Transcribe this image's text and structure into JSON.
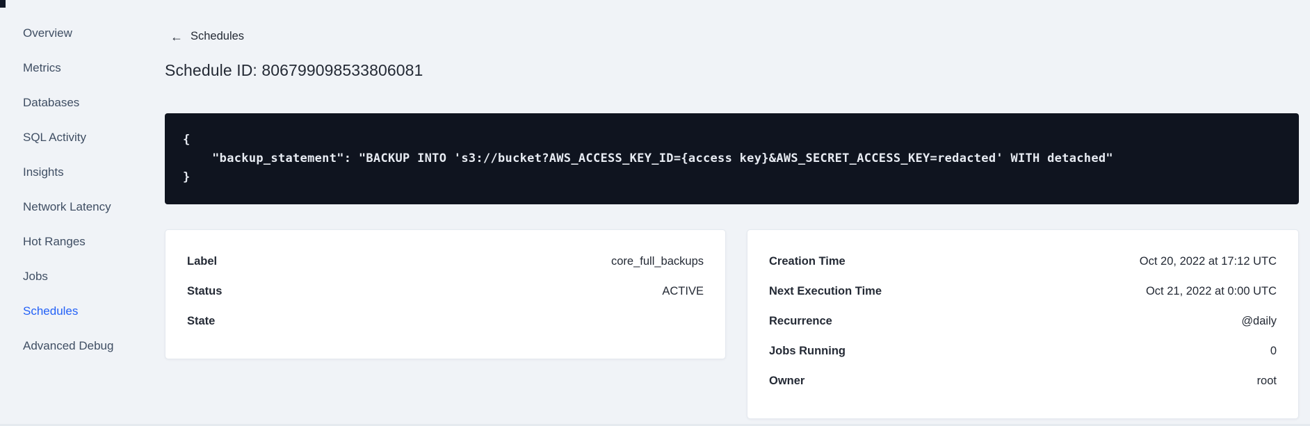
{
  "sidebar": {
    "items": [
      {
        "label": "Overview",
        "active": false
      },
      {
        "label": "Metrics",
        "active": false
      },
      {
        "label": "Databases",
        "active": false
      },
      {
        "label": "SQL Activity",
        "active": false
      },
      {
        "label": "Insights",
        "active": false
      },
      {
        "label": "Network Latency",
        "active": false
      },
      {
        "label": "Hot Ranges",
        "active": false
      },
      {
        "label": "Jobs",
        "active": false
      },
      {
        "label": "Schedules",
        "active": true
      },
      {
        "label": "Advanced Debug",
        "active": false
      }
    ]
  },
  "header": {
    "back_icon": "←",
    "back_label": "Schedules",
    "title": "Schedule ID: 806799098533806081"
  },
  "code_block": {
    "lines": [
      "{",
      "    \"backup_statement\": \"BACKUP INTO 's3://bucket?AWS_ACCESS_KEY_ID={access key}&AWS_SECRET_ACCESS_KEY=redacted' WITH detached\"",
      "}"
    ]
  },
  "details_left": {
    "rows": [
      {
        "label": "Label",
        "value": "core_full_backups"
      },
      {
        "label": "Status",
        "value": "ACTIVE"
      },
      {
        "label": "State",
        "value": ""
      }
    ]
  },
  "details_right": {
    "rows": [
      {
        "label": "Creation Time",
        "value": "Oct 20, 2022 at 17:12 UTC"
      },
      {
        "label": "Next Execution Time",
        "value": "Oct 21, 2022 at 0:00 UTC"
      },
      {
        "label": "Recurrence",
        "value": "@daily"
      },
      {
        "label": "Jobs Running",
        "value": "0"
      },
      {
        "label": "Owner",
        "value": "root"
      }
    ]
  },
  "colors": {
    "page_bg": "#f0f3f7",
    "dark_text": "#242a35",
    "sidebar_text": "#3f4e63",
    "accent_blue": "#2361f7",
    "code_bg": "#0f141f",
    "code_text": "#e7ebf2",
    "card_bg": "#ffffff",
    "card_border": "#e4e9ef"
  }
}
